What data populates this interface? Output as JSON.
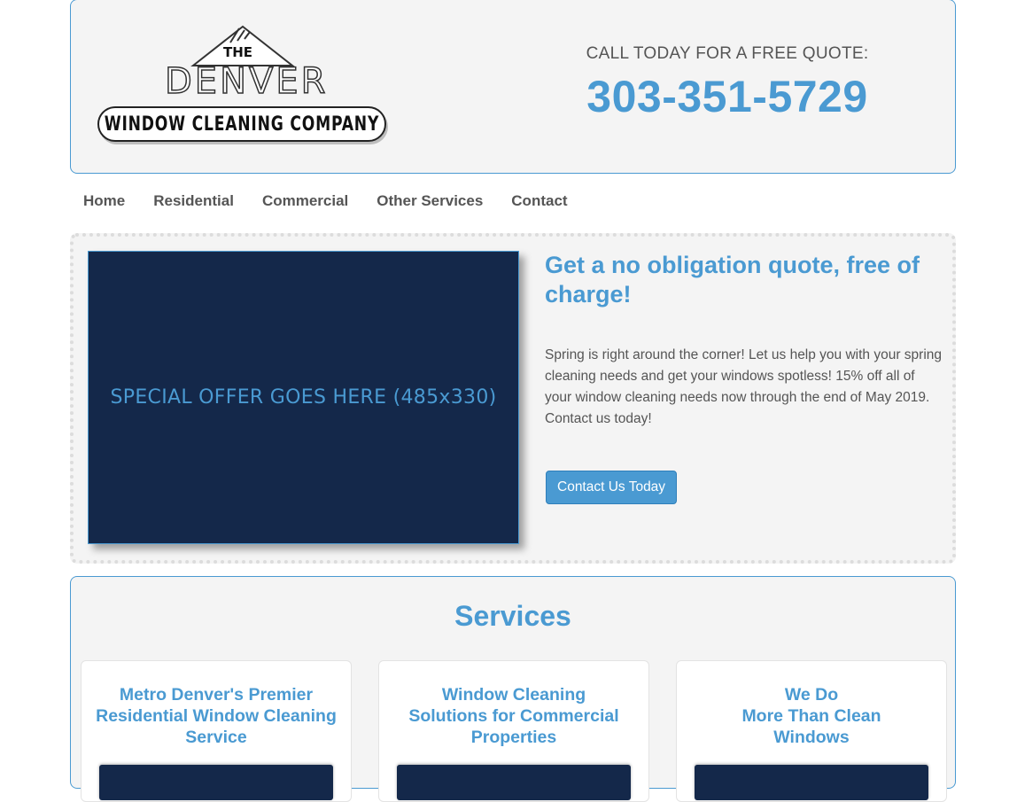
{
  "header": {
    "logo": {
      "the": "THE",
      "denver": "DENVER",
      "tagline": "WINDOW CLEANING COMPANY"
    },
    "quote_label": "CALL TODAY FOR A FREE QUOTE:",
    "phone": "303-351-5729"
  },
  "nav": {
    "items": [
      "Home",
      "Residential",
      "Commercial",
      "Other Services",
      "Contact"
    ]
  },
  "offer": {
    "image_placeholder": "SPECIAL OFFER GOES HERE (485x330)",
    "title": "Get a no obligation quote, free of charge!",
    "body": "Spring is right around the corner! Let us help you with your spring cleaning needs and get your windows spotless! 15% off all of your window cleaning needs now through the end of May 2019. Contact us today!",
    "button": "Contact Us Today"
  },
  "services": {
    "title": "Services",
    "cards": [
      {
        "lines": [
          "Metro Denver's Premier",
          "Residential Window Cleaning",
          "Service"
        ]
      },
      {
        "lines": [
          "Window Cleaning",
          "Solutions for Commercial",
          "Properties"
        ]
      },
      {
        "lines": [
          "We Do",
          "More Than Clean",
          "Windows"
        ]
      }
    ]
  },
  "colors": {
    "accent": "#4a9ad2",
    "navy": "#14284a",
    "panel": "#f4f4f4",
    "text": "#555555"
  }
}
